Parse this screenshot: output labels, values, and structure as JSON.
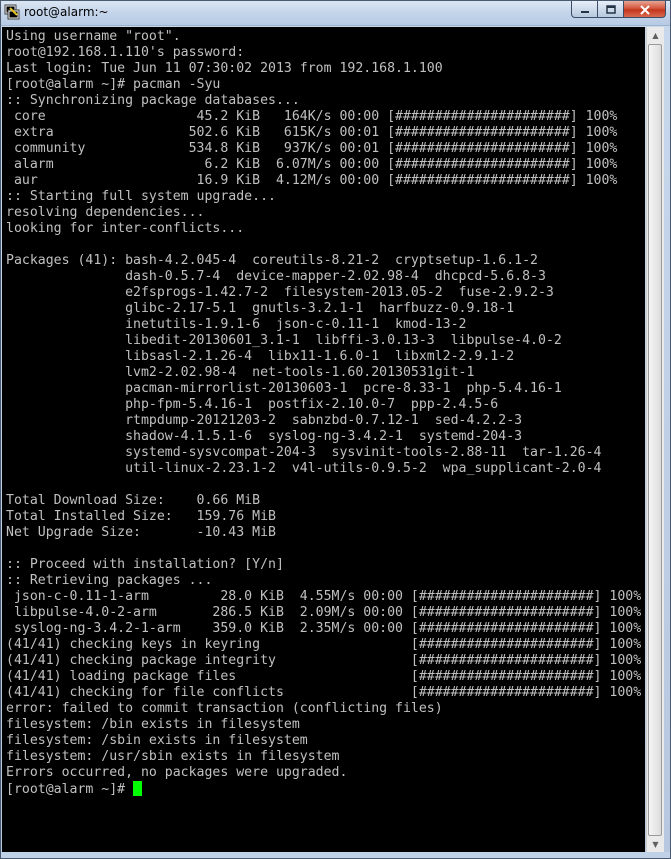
{
  "window": {
    "title": "root@alarm:~",
    "icon": "putty-terminal-icon"
  },
  "controls": {
    "minimize": "—",
    "maximize": "□",
    "close": "✕"
  },
  "terminal": {
    "background": "#000000",
    "foreground": "#c0c0c0",
    "cursor_color": "#00ff00",
    "lines": [
      "Using username \"root\".",
      "root@192.168.1.110's password:",
      "Last login: Tue Jun 11 07:30:02 2013 from 192.168.1.100",
      "[root@alarm ~]# pacman -Syu",
      ":: Synchronizing package databases...",
      " core                   45.2 KiB   164K/s 00:00 [######################] 100%",
      " extra                 502.6 KiB   615K/s 00:01 [######################] 100%",
      " community             534.8 KiB   937K/s 00:01 [######################] 100%",
      " alarm                   6.2 KiB  6.07M/s 00:00 [######################] 100%",
      " aur                    16.9 KiB  4.12M/s 00:00 [######################] 100%",
      ":: Starting full system upgrade...",
      "resolving dependencies...",
      "looking for inter-conflicts...",
      "",
      "Packages (41): bash-4.2.045-4  coreutils-8.21-2  cryptsetup-1.6.1-2",
      "               dash-0.5.7-4  device-mapper-2.02.98-4  dhcpcd-5.6.8-3",
      "               e2fsprogs-1.42.7-2  filesystem-2013.05-2  fuse-2.9.2-3",
      "               glibc-2.17-5.1  gnutls-3.2.1-1  harfbuzz-0.9.18-1",
      "               inetutils-1.9.1-6  json-c-0.11-1  kmod-13-2",
      "               libedit-20130601_3.1-1  libffi-3.0.13-3  libpulse-4.0-2",
      "               libsasl-2.1.26-4  libx11-1.6.0-1  libxml2-2.9.1-2",
      "               lvm2-2.02.98-4  net-tools-1.60.20130531git-1",
      "               pacman-mirrorlist-20130603-1  pcre-8.33-1  php-5.4.16-1",
      "               php-fpm-5.4.16-1  postfix-2.10.0-7  ppp-2.4.5-6",
      "               rtmpdump-20121203-2  sabnzbd-0.7.12-1  sed-4.2.2-3",
      "               shadow-4.1.5.1-6  syslog-ng-3.4.2-1  systemd-204-3",
      "               systemd-sysvcompat-204-3  sysvinit-tools-2.88-11  tar-1.26-4",
      "               util-linux-2.23.1-2  v4l-utils-0.9.5-2  wpa_supplicant-2.0-4",
      "",
      "Total Download Size:    0.66 MiB",
      "Total Installed Size:   159.76 MiB",
      "Net Upgrade Size:       -10.43 MiB",
      "",
      ":: Proceed with installation? [Y/n]",
      ":: Retrieving packages ...",
      " json-c-0.11-1-arm         28.0 KiB  4.55M/s 00:00 [######################] 100%",
      " libpulse-4.0-2-arm       286.5 KiB  2.09M/s 00:00 [######################] 100%",
      " syslog-ng-3.4.2-1-arm    359.0 KiB  2.35M/s 00:00 [######################] 100%",
      "(41/41) checking keys in keyring                   [######################] 100%",
      "(41/41) checking package integrity                 [######################] 100%",
      "(41/41) loading package files                      [######################] 100%",
      "(41/41) checking for file conflicts                [######################] 100%",
      "error: failed to commit transaction (conflicting files)",
      "filesystem: /bin exists in filesystem",
      "filesystem: /sbin exists in filesystem",
      "filesystem: /usr/sbin exists in filesystem",
      "Errors occurred, no packages were upgraded."
    ],
    "prompt": "[root@alarm ~]# "
  },
  "scrollbar": {
    "up_glyph": "▲",
    "down_glyph": "▼"
  }
}
